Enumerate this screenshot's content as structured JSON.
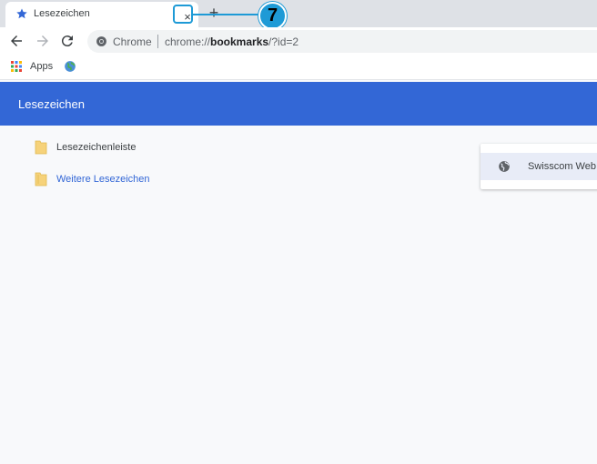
{
  "tab": {
    "title": "Lesezeichen",
    "close_symbol": "×",
    "new_tab_symbol": "+"
  },
  "callout": {
    "number": "7",
    "color": "#1e9ad6"
  },
  "toolbar": {
    "site_chip": "Chrome",
    "url_prefix": "chrome://",
    "url_bold": "bookmarks",
    "url_suffix": "/?id=2"
  },
  "bookmarks_bar": {
    "apps_label": "Apps"
  },
  "header": {
    "title": "Lesezeichen",
    "color": "#3367d6"
  },
  "folders": [
    {
      "label": "Lesezeichenleiste",
      "active": false
    },
    {
      "label": "Weitere Lesezeichen",
      "active": true
    }
  ],
  "bookmarks": [
    {
      "label": "Swisscom Web"
    }
  ],
  "icons": {
    "tab_favicon": "star-icon",
    "back": "arrow-left-icon",
    "forward": "arrow-right-icon",
    "reload": "reload-icon",
    "site_info": "chrome-logo-icon",
    "apps": "apps-grid-icon",
    "folder": "folder-icon",
    "bookmark": "globe-icon"
  }
}
